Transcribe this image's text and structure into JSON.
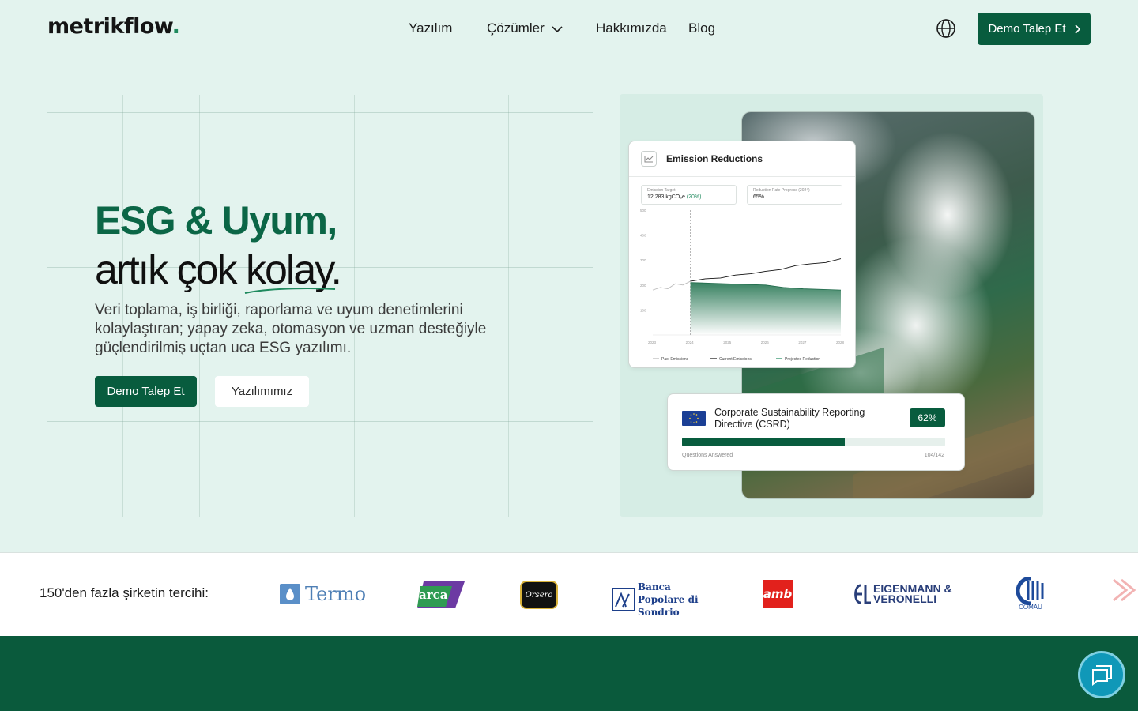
{
  "header": {
    "logo": "metrikflow",
    "logo_dot": ".",
    "nav": [
      {
        "label": "Yazılım"
      },
      {
        "label": "Çözümler"
      },
      {
        "label": "Hakkımızda"
      },
      {
        "label": "Blog"
      }
    ],
    "cta": "Demo Talep Et"
  },
  "hero": {
    "title_line1": "ESG & Uyum,",
    "title_line2": "artık çok kolay.",
    "subtitle": "Veri toplama, iş birliği, raporlama ve uyum denetimlerini kolaylaştıran; yapay zeka, otomasyon ve uzman desteğiyle güçlendirilmiş uçtan uca ESG yazılımı.",
    "primary_button": "Demo Talep Et",
    "secondary_button": "Yazılımımız"
  },
  "emission_card": {
    "title": "Emission Reductions",
    "target_label": "Emission Target",
    "target_value": "12,283 kgCO₂e",
    "target_pct": "(20%)",
    "rate_label": "Reduction Rate Progress (2024)",
    "rate_value": "65%",
    "legend": [
      "Past Emissions",
      "Current Emissions",
      "Projected Reduction"
    ]
  },
  "chart_data": {
    "type": "line",
    "title": "Emission Reductions",
    "x": [
      2023,
      2024,
      2025,
      2026,
      2027,
      2028
    ],
    "ylim": [
      0,
      500
    ],
    "yticks": [
      100,
      200,
      300,
      400,
      500
    ],
    "series": [
      {
        "name": "Past Emissions",
        "x": [
          2023,
          2023.2,
          2023.4,
          2023.6,
          2023.8,
          2024
        ],
        "values": [
          180,
          190,
          185,
          205,
          200,
          215
        ]
      },
      {
        "name": "Current Emissions",
        "x": [
          2024,
          2024.4,
          2024.8,
          2025.2,
          2025.6,
          2026,
          2026.4,
          2026.8,
          2027.2,
          2027.6,
          2028
        ],
        "values": [
          215,
          225,
          228,
          240,
          245,
          255,
          262,
          278,
          285,
          290,
          305
        ]
      },
      {
        "name": "Projected Reduction",
        "x": [
          2024,
          2025,
          2026,
          2026.5,
          2027,
          2028
        ],
        "values": [
          210,
          205,
          200,
          190,
          185,
          180
        ]
      }
    ]
  },
  "csrd_card": {
    "title": "Corporate Sustainability Reporting Directive (CSRD)",
    "percent": "62%",
    "progress": 0.62,
    "questions_label": "Questions Answered",
    "count": "104/142"
  },
  "clients": {
    "label": "150'den fazla şirketin tercihi:",
    "brands": [
      "Termo",
      "arca",
      "Orsero",
      "Banca Popolare di Sondrio",
      "amb",
      "EIGENMANN & VERONELLI",
      "COMAU"
    ]
  },
  "colors": {
    "accent": "#085c3e",
    "hero_bg": "#e3f3ee",
    "heading_green": "#0b6646"
  }
}
